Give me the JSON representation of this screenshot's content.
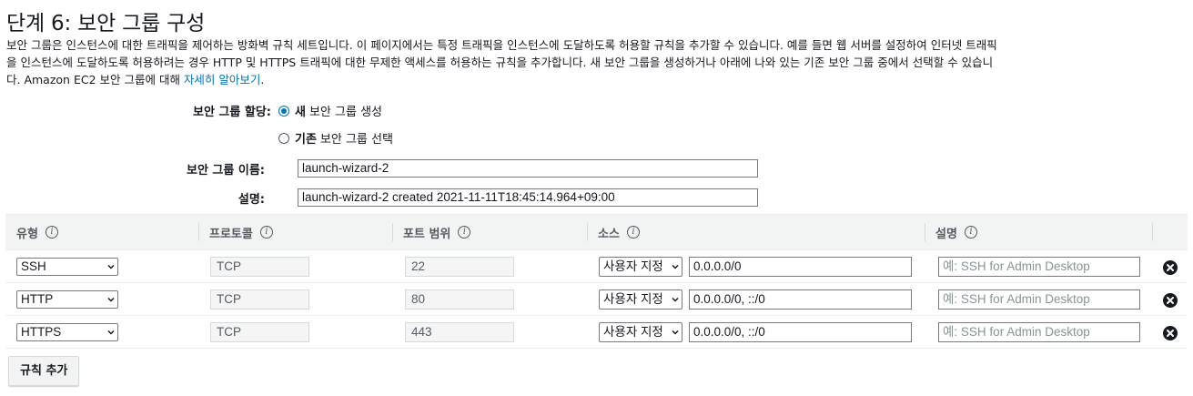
{
  "page": {
    "title": "단계 6: 보안 그룹 구성",
    "desc_line1": "보안 그룹은 인스턴스에 대한 트래픽을 제어하는 방화벽 규칙 세트입니다. 이 페이지에서는 특정 트래픽을 인스턴스에 도달하도록 허용할 규칙을 추가할 수 있습니다. 예를 들면 웹 서버를 설정하여 인터넷 트래픽",
    "desc_line2": "을 인스턴스에 도달하도록 허용하려는 경우 HTTP 및 HTTPS 트래픽에 대한 무제한 액세스를 허용하는 규칙을 추가합니다. 새 보안 그룹을 생성하거나 아래에 나와 있는 기존 보안 그룹 중에서 선택할 수 있습니",
    "desc_line3": "다. Amazon EC2 보안 그룹에 대해 ",
    "learn_more": "자세히 알아보기",
    "desc_end": "."
  },
  "form": {
    "assign_label": "보안 그룹 할당:",
    "new_bold": "새",
    "new_rest": "보안 그룹 생성",
    "existing_bold": "기존",
    "existing_rest": "보안 그룹 선택",
    "name_label": "보안 그룹 이름:",
    "name_value": "launch-wizard-2",
    "desc_label": "설명:",
    "desc_value": "launch-wizard-2 created 2021-11-11T18:45:14.964+09:00"
  },
  "table": {
    "headers": {
      "type": "유형",
      "protocol": "프로토콜",
      "port": "포트 범위",
      "source": "소스",
      "description": "설명"
    },
    "info_glyph": "i",
    "rows": [
      {
        "type": "SSH",
        "protocol": "TCP",
        "port": "22",
        "source_select": "사용자 지정",
        "source": "0.0.0.0/0",
        "desc_placeholder": "예: SSH for Admin Desktop"
      },
      {
        "type": "HTTP",
        "protocol": "TCP",
        "port": "80",
        "source_select": "사용자 지정",
        "source": "0.0.0.0/0, ::/0",
        "desc_placeholder": "예: SSH for Admin Desktop"
      },
      {
        "type": "HTTPS",
        "protocol": "TCP",
        "port": "443",
        "source_select": "사용자 지정",
        "source": "0.0.0.0/0, ::/0",
        "desc_placeholder": "예: SSH for Admin Desktop"
      }
    ]
  },
  "actions": {
    "add_rule": "규칙 추가"
  },
  "colors": {
    "link": "#0073bb",
    "radio_selected": "#0073bb",
    "header_bg": "#f2f3f3"
  },
  "icons": {
    "info": "info-icon",
    "remove": "remove-circle-icon",
    "dropdown": "chevron-down-icon"
  }
}
